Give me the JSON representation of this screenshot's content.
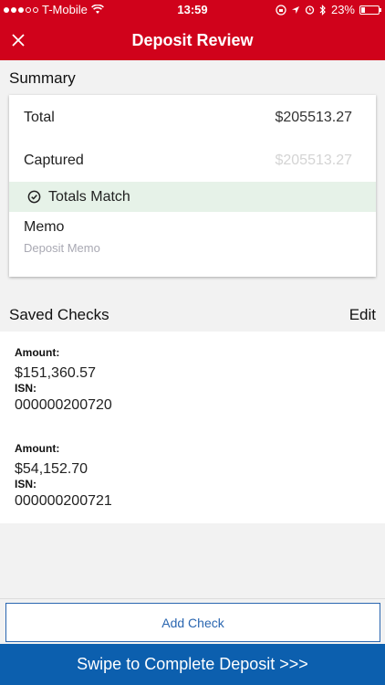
{
  "status_bar": {
    "carrier": "T-Mobile",
    "time": "13:59",
    "battery": "23%",
    "battery_level": 0.23
  },
  "nav": {
    "title": "Deposit Review",
    "close_icon": "close-icon"
  },
  "summary": {
    "title": "Summary",
    "total_label": "Total",
    "total_value": "$205513.27",
    "captured_label": "Captured",
    "captured_value": "$205513.27",
    "match_text": "Totals Match",
    "memo_label": "Memo",
    "memo_placeholder": "Deposit Memo"
  },
  "saved_checks": {
    "title": "Saved Checks",
    "edit_label": "Edit",
    "items": [
      {
        "amount_label": "Amount:",
        "amount": "$151,360.57",
        "isn_label": "ISN:",
        "isn": "000000200720"
      },
      {
        "amount_label": "Amount:",
        "amount": "$54,152.70",
        "isn_label": "ISN:",
        "isn": "000000200721"
      }
    ]
  },
  "actions": {
    "add_check": "Add Check",
    "swipe": "Swipe to Complete Deposit >>>"
  },
  "colors": {
    "brand_red": "#d0021b",
    "action_blue": "#0c5fae",
    "match_green_bg": "#e6f2e8"
  }
}
